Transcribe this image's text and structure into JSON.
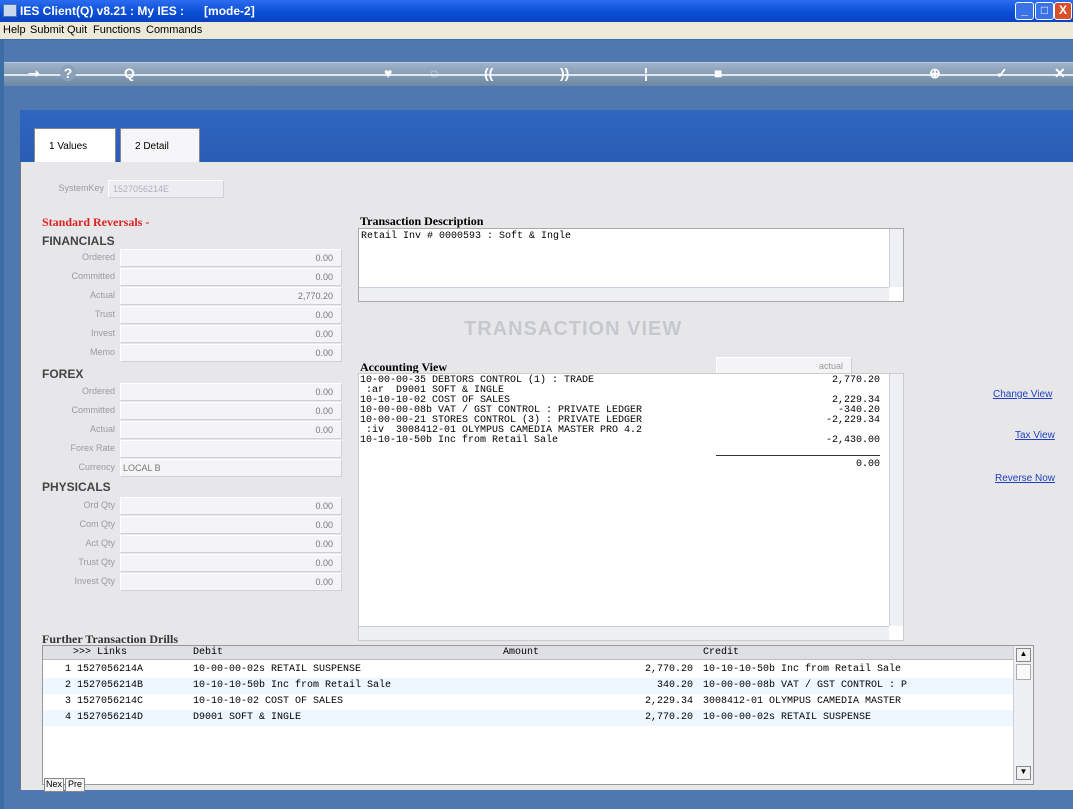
{
  "window": {
    "title": "IES Client(Q) v8.21 : My IES :      [mode-2]",
    "minimize": "_",
    "maximize": "□",
    "close": "X"
  },
  "menu": [
    "Help",
    "Submit",
    "Quit",
    "Functions",
    "Commands"
  ],
  "toolbar": {
    "question": "?",
    "search": "Q",
    "back": "((",
    "fwd": "))"
  },
  "tabs": [
    {
      "label": "1 Values"
    },
    {
      "label": "2 Detail"
    }
  ],
  "system_key": {
    "label": "SystemKey",
    "value": "1527056214E"
  },
  "standard_reversal": "Standard Reversals -",
  "financials": {
    "title": "FINANCIALS",
    "rows": [
      {
        "label": "Ordered",
        "value": "0.00"
      },
      {
        "label": "Committed",
        "value": "0.00"
      },
      {
        "label": "Actual",
        "value": "2,770.20"
      },
      {
        "label": "Trust",
        "value": "0.00"
      },
      {
        "label": "Invest",
        "value": "0.00"
      },
      {
        "label": "Memo",
        "value": "0.00"
      }
    ]
  },
  "forex": {
    "title": "FOREX",
    "rows": [
      {
        "label": "Ordered",
        "value": "0.00"
      },
      {
        "label": "Committed",
        "value": "0.00"
      },
      {
        "label": "Actual",
        "value": "0.00"
      },
      {
        "label": "Forex Rate",
        "value": ""
      },
      {
        "label": "Currency",
        "value": "LOCAL B"
      }
    ]
  },
  "physicals": {
    "title": "PHYSICALS",
    "rows": [
      {
        "label": "Ord Qty",
        "value": "0.00"
      },
      {
        "label": "Com Qty",
        "value": "0.00"
      },
      {
        "label": "Act Qty",
        "value": "0.00"
      },
      {
        "label": "Trust Qty",
        "value": "0.00"
      },
      {
        "label": "Invest Qty",
        "value": "0.00"
      }
    ]
  },
  "transaction_description": {
    "title": "Transaction Description",
    "text": "Retail Inv # 0000593 : Soft & Ingle"
  },
  "transaction_view_title": "TRANSACTION VIEW",
  "accounting_view": {
    "title": "Accounting View",
    "mode": "actual",
    "lines": [
      {
        "text": "10-00-00-35 DEBTORS CONTROL (1) : TRADE",
        "amount": "2,770.20"
      },
      {
        "text": " :ar  D9001 SOFT & INGLE",
        "amount": ""
      },
      {
        "text": "10-10-10-02 COST OF SALES",
        "amount": "2,229.34"
      },
      {
        "text": "10-00-00-08b VAT / GST CONTROL : PRIVATE LEDGER",
        "amount": "-340.20"
      },
      {
        "text": "10-00-00-21 STORES CONTROL (3) : PRIVATE LEDGER",
        "amount": "-2,229.34"
      },
      {
        "text": " :iv  3008412-01 OLYMPUS CAMEDIA MASTER PRO 4.2",
        "amount": ""
      },
      {
        "text": "10-10-10-50b Inc from Retail Sale",
        "amount": "-2,430.00"
      }
    ],
    "total": "0.00"
  },
  "side_links": {
    "change_view": "Change View",
    "tax_view": "Tax View",
    "reverse_now": "Reverse Now"
  },
  "drills": {
    "title": "Further Transaction Drills",
    "headers": {
      "links": ">>> Links",
      "debit": "Debit",
      "amount": "Amount",
      "credit": "Credit"
    },
    "rows": [
      {
        "n": "1",
        "link": "1527056214A",
        "debit": "10-00-00-02s RETAIL SUSPENSE",
        "amount": "2,770.20",
        "credit": "10-10-10-50b Inc from Retail Sale"
      },
      {
        "n": "2",
        "link": "1527056214B",
        "debit": "10-10-10-50b Inc from Retail Sale",
        "amount": "340.20",
        "credit": "10-00-00-08b VAT / GST CONTROL : P"
      },
      {
        "n": "3",
        "link": "1527056214C",
        "debit": "10-10-10-02 COST OF SALES",
        "amount": "2,229.34",
        "credit": "3008412-01 OLYMPUS CAMEDIA MASTER"
      },
      {
        "n": "4",
        "link": "1527056214D",
        "debit": "D9001 SOFT & INGLE",
        "amount": "2,770.20",
        "credit": "10-00-00-02s RETAIL SUSPENSE"
      }
    ]
  },
  "bottom_buttons": {
    "nex": "Nex",
    "pre": "Pre"
  }
}
